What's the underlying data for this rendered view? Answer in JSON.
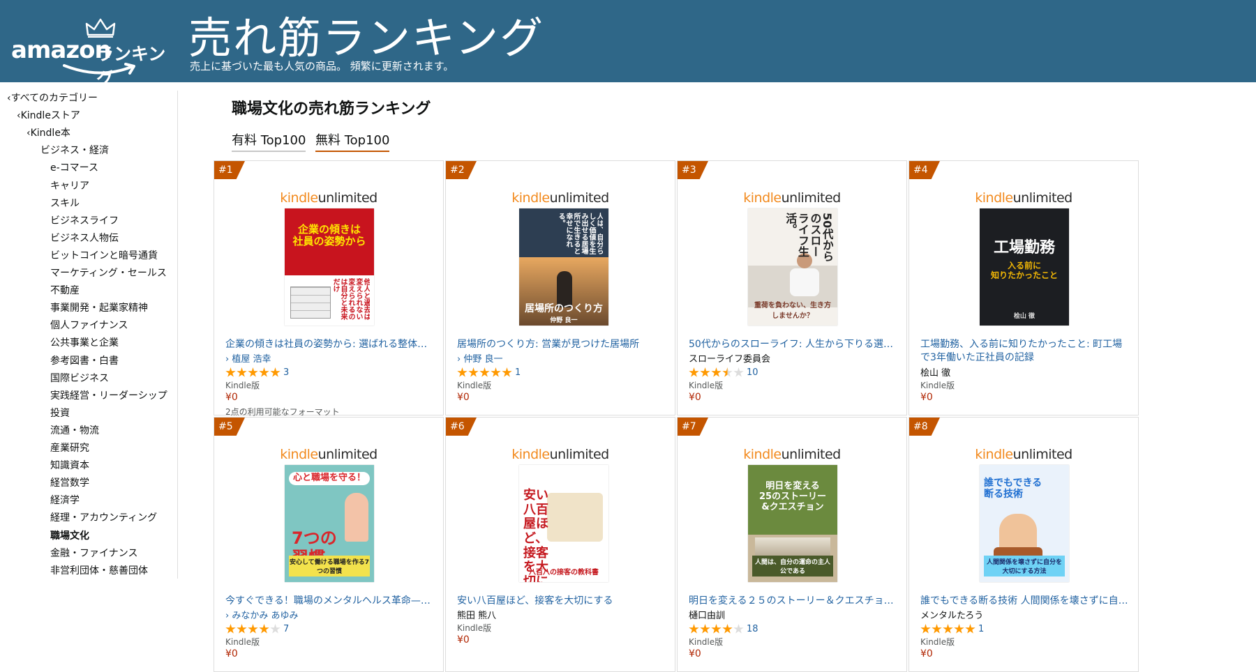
{
  "header": {
    "logo_word": "amazon",
    "logo_rank": "ランキング",
    "title": "売れ筋ランキング",
    "subtitle": "売上に基づいた最も人気の商品。 頻繁に更新されます。"
  },
  "sidebar": {
    "items": [
      {
        "label": "‹すべてのカテゴリー",
        "level": 0
      },
      {
        "label": "‹Kindleストア",
        "level": 1
      },
      {
        "label": "‹Kindle本",
        "level": 2
      },
      {
        "label": "ビジネス・経済",
        "level": 3
      },
      {
        "label": "e-コマース",
        "level": 4
      },
      {
        "label": "キャリア",
        "level": 4
      },
      {
        "label": "スキル",
        "level": 4
      },
      {
        "label": "ビジネスライフ",
        "level": 4
      },
      {
        "label": "ビジネス人物伝",
        "level": 4
      },
      {
        "label": "ビットコインと暗号通貨",
        "level": 4
      },
      {
        "label": "マーケティング・セールス",
        "level": 4
      },
      {
        "label": "不動産",
        "level": 4
      },
      {
        "label": "事業開発・起業家精神",
        "level": 4
      },
      {
        "label": "個人ファイナンス",
        "level": 4
      },
      {
        "label": "公共事業と企業",
        "level": 4
      },
      {
        "label": "参考図書・白書",
        "level": 4
      },
      {
        "label": "国際ビジネス",
        "level": 4
      },
      {
        "label": "実践経営・リーダーシップ",
        "level": 4
      },
      {
        "label": "投資",
        "level": 4
      },
      {
        "label": "流通・物流",
        "level": 4
      },
      {
        "label": "産業研究",
        "level": 4
      },
      {
        "label": "知識資本",
        "level": 4
      },
      {
        "label": "経営数学",
        "level": 4
      },
      {
        "label": "経済学",
        "level": 4
      },
      {
        "label": "経理・アカウンティング",
        "level": 4
      },
      {
        "label": "職場文化",
        "level": 4,
        "active": true
      },
      {
        "label": "金融・ファイナンス",
        "level": 4
      },
      {
        "label": "非営利団体・慈善団体",
        "level": 4
      }
    ]
  },
  "main": {
    "title": "職場文化の売れ筋ランキング",
    "tabs": [
      {
        "label": "有料 Top100"
      },
      {
        "label": "無料 Top100"
      }
    ]
  },
  "kindle_unlimited": {
    "k": "kindle",
    "u": "unlimited"
  },
  "books": [
    {
      "rank": "#1",
      "title": "企業の傾きは社員の姿勢から: 選ばれる整体…",
      "author": "› 植屋 浩幸",
      "author_link": true,
      "rating": 5,
      "reviews": "3",
      "format": "Kindle版",
      "price": "¥0",
      "extra": "2点の利用可能なフォーマット",
      "cover": {
        "bg": "#ffffff",
        "panel": "#c8141e",
        "title": "企業の傾きは\n社員の姿勢から",
        "title_color": "#ffe600",
        "foot": "",
        "vertical": "他人と過去は変えられない 変えられるのは自分と未来だけ"
      }
    },
    {
      "rank": "#2",
      "title": "居場所のつくり方: 営業が見つけた居場所",
      "author": "› 仲野 良一",
      "author_link": true,
      "rating": 5,
      "reviews": "1",
      "format": "Kindle版",
      "price": "¥0",
      "extra": "",
      "cover": {
        "bg": "#c98a4a",
        "panel": "#2d3e52",
        "title": "居場所のつくり方",
        "title_color": "#ffffff",
        "foot": "仲野 良一",
        "vertical": "人は、自分らしく価値を生み出せる居場所で生きると幸せになれる。"
      }
    },
    {
      "rank": "#3",
      "title": "50代からのスローライフ: 人生から下りる選…",
      "author": "スローライフ委員会",
      "author_link": false,
      "rating": 3.5,
      "reviews": "10",
      "format": "Kindle版",
      "price": "¥0",
      "extra": "",
      "cover": {
        "bg": "#f4f1ec",
        "panel": "#dcd7cf",
        "title": "50代からのスローライフ生活。",
        "title_color": "#222222",
        "foot": "重荷を負わない、生き方しませんか？",
        "vertical": "50代からのスローライフ生活。"
      }
    },
    {
      "rank": "#4",
      "title": "工場勤務、入る前に知りたかったこと: 町工場で3年働いた正社員の記録",
      "author": "桧山 徹",
      "author_link": false,
      "rating": 0,
      "reviews": "",
      "format": "Kindle版",
      "price": "¥0",
      "extra": "",
      "cover": {
        "bg": "#1c1e22",
        "panel": "#1c1e22",
        "title": "工場勤務",
        "title_color": "#ffffff",
        "subtitle": "入る前に\n知りたかったこと",
        "subtitle_color": "#f2b705",
        "foot": "桧山 徹",
        "vertical": ""
      }
    },
    {
      "rank": "#5",
      "title": "今すぐできる！職場のメンタルヘルス革命—…",
      "author": "› みなかみ あゆみ",
      "author_link": true,
      "rating": 4,
      "reviews": "7",
      "format": "Kindle版",
      "price": "¥0",
      "extra": "",
      "cover": {
        "bg": "#7fc6c2",
        "panel": "#f3e24c",
        "title": "心と職場を守る！",
        "title_color": "#d9262b",
        "foot": "安心して働ける職場を作る7つの習慣",
        "big": "7つの習慣",
        "vertical": ""
      }
    },
    {
      "rank": "#6",
      "title": "安い八百屋ほど、接客を大切にする",
      "author": "熊田 熊八",
      "author_link": false,
      "rating": 0,
      "reviews": "",
      "format": "Kindle版",
      "price": "¥0",
      "extra": "",
      "cover": {
        "bg": "#ffffff",
        "panel": "#f0e3c8",
        "title": "安い八百屋ほど、\n接客を大切にする。",
        "title_color": "#c5191f",
        "foot": "八百八の接客の教科書",
        "vertical": ""
      }
    },
    {
      "rank": "#7",
      "title": "明日を変える２５のストーリー＆クエスチョ…",
      "author": "樋口由訓",
      "author_link": false,
      "rating": 4,
      "reviews": "18",
      "format": "Kindle版",
      "price": "¥0",
      "extra": "",
      "cover": {
        "bg": "#c9b89a",
        "panel": "#6b8a3e",
        "title": "明日を変える\n25のストーリー\n&クエスチョン",
        "title_color": "#ffffff",
        "foot": "人間は、自分の運命の主人公である",
        "vertical": ""
      }
    },
    {
      "rank": "#8",
      "title": "誰でもできる断る技術 人間関係を壊さずに自…",
      "author": "メンタルたろう",
      "author_link": false,
      "rating": 5,
      "reviews": "1",
      "format": "Kindle版",
      "price": "¥0",
      "extra": "",
      "cover": {
        "bg": "#eaf2fb",
        "panel": "#1f6fd1",
        "title": "誰でもできる\n断る技術",
        "title_color": "#1f6fd1",
        "foot": "人間関係を壊さずに自分を大切にする方法",
        "vertical": ""
      }
    }
  ],
  "colors": {
    "banner": "#2f6788",
    "badge": "#c45500",
    "link": "#2162a1",
    "star": "#ff9900",
    "price": "#b12704"
  }
}
